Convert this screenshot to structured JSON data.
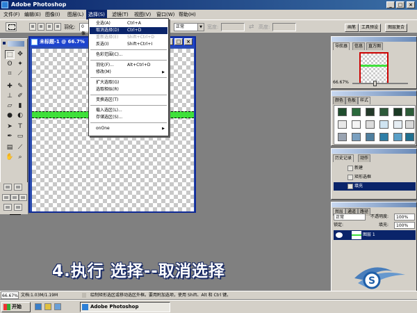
{
  "window": {
    "title": "Adobe Photoshop"
  },
  "menubar": {
    "items": [
      {
        "label": "文件(F)"
      },
      {
        "label": "编辑(E)"
      },
      {
        "label": "图像(I)"
      },
      {
        "label": "图层(L)"
      },
      {
        "label": "选择(S)"
      },
      {
        "label": "滤镜(T)"
      },
      {
        "label": "视图(V)"
      },
      {
        "label": "窗口(W)"
      },
      {
        "label": "帮助(H)"
      }
    ],
    "active_index": 4
  },
  "options_bar": {
    "feather_label": "羽化:",
    "feather_value": "0 像素",
    "style_value": "正常",
    "width_label": "宽度:",
    "height_label": "高度:",
    "palette_tabs": [
      "画笔",
      "工具预设",
      "图层复合"
    ]
  },
  "document": {
    "title": "未标题-1 @ 66.7%"
  },
  "select_menu": {
    "items": [
      {
        "label": "全选(A)",
        "shortcut": "Ctrl+A",
        "state": "normal"
      },
      {
        "label": "取消选择(D)",
        "shortcut": "Ctrl+D",
        "state": "highlight"
      },
      {
        "label": "重新选择(E)",
        "shortcut": "Shift+Ctrl+D",
        "state": "disabled"
      },
      {
        "label": "反选(I)",
        "shortcut": "Shift+Ctrl+I",
        "state": "normal"
      },
      {
        "label": "色彩范围(C)...",
        "shortcut": "",
        "state": "normal"
      },
      {
        "label": "羽化(F)...",
        "shortcut": "Alt+Ctrl+D",
        "state": "normal"
      },
      {
        "label": "修改(M)",
        "shortcut": "",
        "state": "normal"
      },
      {
        "label": "扩大选取(G)",
        "shortcut": "",
        "state": "normal"
      },
      {
        "label": "选取相似(R)",
        "shortcut": "",
        "state": "normal"
      },
      {
        "label": "变换选区(T)",
        "shortcut": "",
        "state": "normal"
      },
      {
        "label": "载入选区(L)...",
        "shortcut": "",
        "state": "normal"
      },
      {
        "label": "存储选区(S)...",
        "shortcut": "",
        "state": "normal"
      },
      {
        "label": "onOne",
        "shortcut": "",
        "state": "normal"
      }
    ]
  },
  "navigator": {
    "tabs": [
      "导航器",
      "信息",
      "直方图"
    ],
    "zoom": "66.67%"
  },
  "styles_panel": {
    "tabs": [
      "颜色",
      "色板",
      "样式"
    ]
  },
  "history_panel": {
    "tabs": [
      "历史记录",
      "动作"
    ],
    "items": [
      "新建",
      "矩形选框",
      "填充"
    ]
  },
  "layers_panel": {
    "tabs": [
      "图层",
      "通道",
      "路径"
    ],
    "blend_mode": "正常",
    "opacity_label": "不透明度:",
    "opacity_value": "100%",
    "lock_label": "锁定:",
    "fill_label": "填充:",
    "fill_value": "100%",
    "layer_name": "图层 1"
  },
  "caption": "4.执行 选择--取消选择",
  "status_bar": {
    "zoom": "66.67%",
    "doc_size": "文档:1.03M/1.19M",
    "hint": "绘制矩形选区或移动选区外框。要用附加选项，使用 Shift、Alt 和 Ctrl 键。"
  },
  "taskbar": {
    "start_label": "开始",
    "task_label": "Adobe Photoshop"
  },
  "colors": {
    "foreground": "#d6145a",
    "background": "#ffffff",
    "fill_green": "#3fe03a",
    "selection_blue": "#0a246a"
  }
}
